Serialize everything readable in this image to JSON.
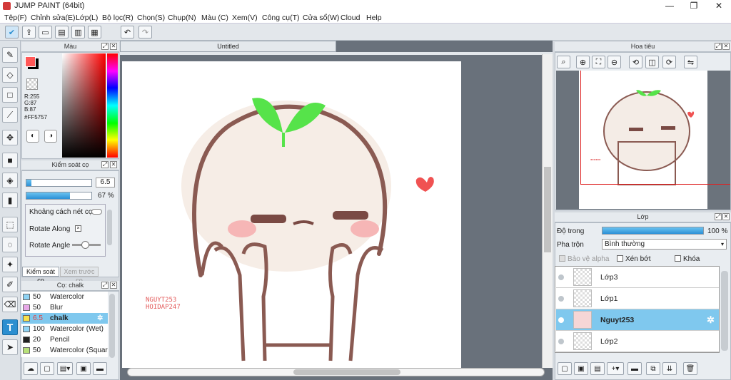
{
  "window": {
    "title": "JUMP PAINT (64bit)",
    "minimize": "—",
    "maximize": "❐",
    "close": "✕"
  },
  "menu": [
    "Tệp(F)",
    "Chỉnh sửa(E)",
    "Lớp(L)",
    "Bộ lọc(R)",
    "Chọn(S)",
    "Chụp(N)",
    "Màu (C)",
    "Xem(V)",
    "Công cụ(T)",
    "Cửa sổ(W)",
    "Cloud",
    "Help"
  ],
  "document": {
    "tab": "Untitled",
    "watermark_line1": "NGUYT253",
    "watermark_line2": "HOIDAP247"
  },
  "color_panel": {
    "title": "Màu",
    "r": "R:255",
    "g": "G:87",
    "b": "B:87",
    "hex": "#FF5757",
    "fg": "#FF5757",
    "bg": "#000000"
  },
  "brush_control": {
    "title": "Kiểm soát cọ",
    "size": "6.5",
    "opacity": "67 %",
    "opacity_fraction": 0.67,
    "spacing_label": "Khoảng cách nét cọ",
    "rotate_along": "Rotate Along",
    "rotate_angle": "Rotate Angle",
    "tab_active": "Kiểm soát cọ",
    "tab_other": "Xem trước cọ"
  },
  "brush_list": {
    "title": "Cọ: chalk",
    "items": [
      {
        "size": "50",
        "name": "Watercolor",
        "color": "#8fd3f4"
      },
      {
        "size": "50",
        "name": "Blur",
        "color": "#e7a8e8"
      },
      {
        "size": "6.5",
        "name": "chalk",
        "color": "#f5e04a",
        "selected": true
      },
      {
        "size": "100",
        "name": "Watercolor (Wet)",
        "color": "#8fd3f4"
      },
      {
        "size": "20",
        "name": "Pencil",
        "color": "#222222"
      },
      {
        "size": "50",
        "name": "Watercolor (Square)",
        "color": "#b7e07a"
      }
    ]
  },
  "navigator": {
    "title": "Hoa tiêu"
  },
  "layers_panel": {
    "title": "Lớp",
    "opacity_label": "Độ trong",
    "opacity": "100 %",
    "blend_label": "Pha trộn",
    "blend": "Bình thường",
    "protect_alpha": "Bảo vệ alpha",
    "clipping": "Xén bớt",
    "lock": "Khóa",
    "layers": [
      {
        "name": "Lớp3"
      },
      {
        "name": "Lớp1"
      },
      {
        "name": "Nguyt253",
        "selected": true
      },
      {
        "name": "Lớp2"
      }
    ]
  },
  "colors": {
    "accent": "#2c8fd0",
    "selection": "#7fc8ee"
  }
}
